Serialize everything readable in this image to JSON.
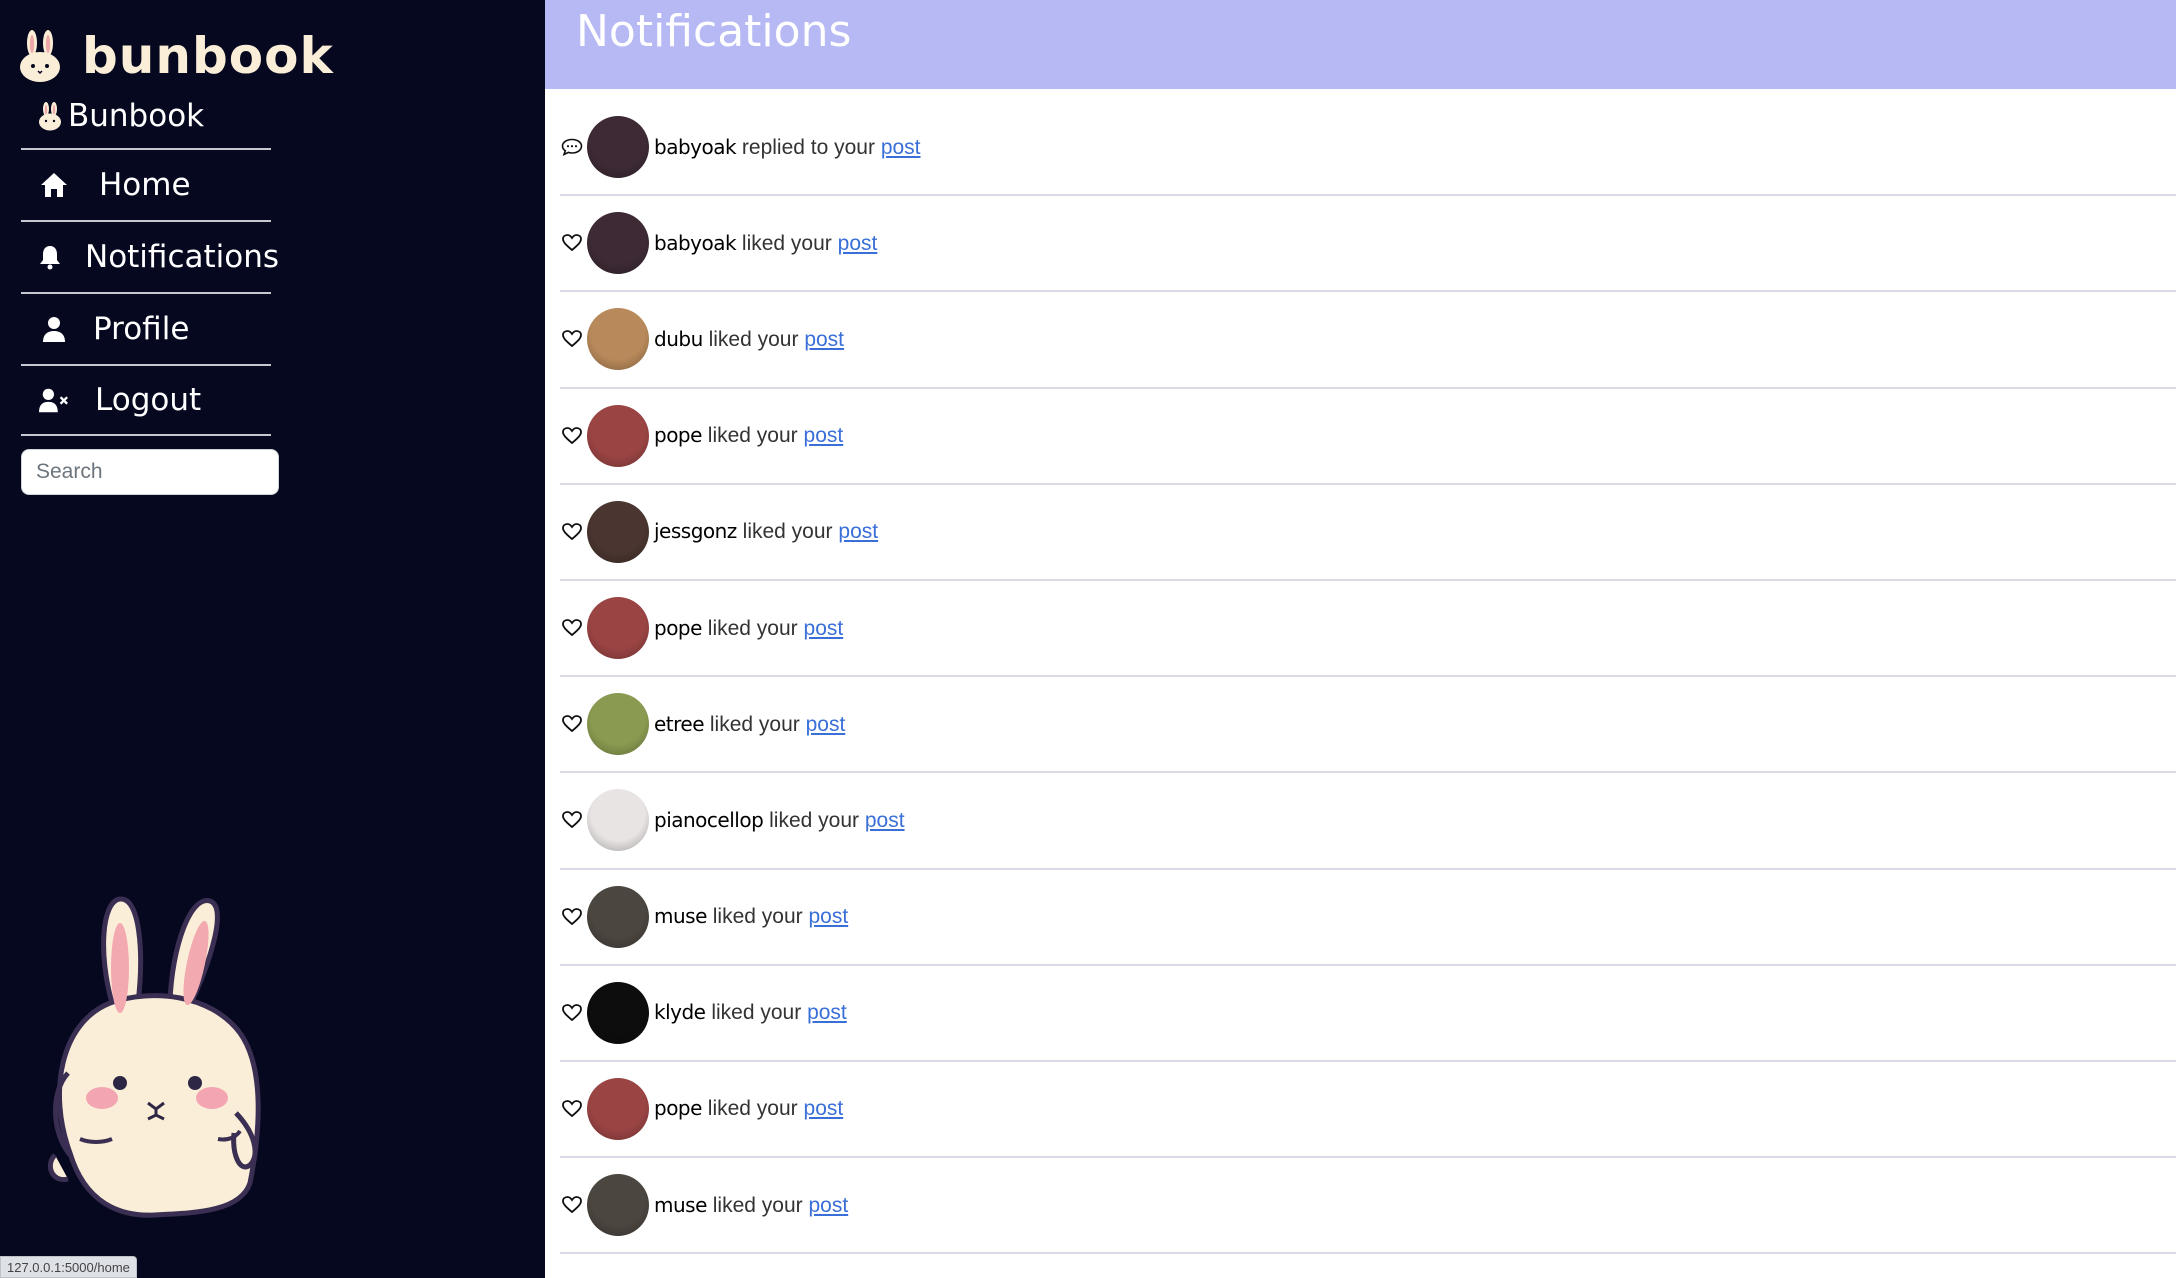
{
  "sidebar": {
    "brand": "bunbook",
    "subbrand": "Bunbook",
    "nav": [
      {
        "label": "Home",
        "icon": "home-icon"
      },
      {
        "label": "Notifications",
        "icon": "bell-icon"
      },
      {
        "label": "Profile",
        "icon": "user-icon"
      },
      {
        "label": "Logout",
        "icon": "user-x-icon"
      }
    ],
    "search_placeholder": "Search"
  },
  "status_url": "127.0.0.1:5000/home",
  "header": {
    "title": "Notifications"
  },
  "notifications": [
    {
      "type": "reply",
      "user": "babyoak",
      "action": "replied to your",
      "link": "post",
      "avatar_color": "#3d2a35"
    },
    {
      "type": "like",
      "user": "babyoak",
      "action": "liked your",
      "link": "post",
      "avatar_color": "#3d2a35"
    },
    {
      "type": "like",
      "user": "dubu",
      "action": "liked your",
      "link": "post",
      "avatar_color": "#b8895a"
    },
    {
      "type": "like",
      "user": "pope",
      "action": "liked your",
      "link": "post",
      "avatar_color": "#9b4444"
    },
    {
      "type": "like",
      "user": "jessgonz",
      "action": "liked your",
      "link": "post",
      "avatar_color": "#4a3530"
    },
    {
      "type": "like",
      "user": "pope",
      "action": "liked your",
      "link": "post",
      "avatar_color": "#9b4444"
    },
    {
      "type": "like",
      "user": "etree",
      "action": "liked your",
      "link": "post",
      "avatar_color": "#8a9a50"
    },
    {
      "type": "like",
      "user": "pianocellop",
      "action": "liked your",
      "link": "post",
      "avatar_color": "#e8e4e4"
    },
    {
      "type": "like",
      "user": "muse",
      "action": "liked your",
      "link": "post",
      "avatar_color": "#4c4640"
    },
    {
      "type": "like",
      "user": "klyde",
      "action": "liked your",
      "link": "post",
      "avatar_color": "#0d0d0d"
    },
    {
      "type": "like",
      "user": "pope",
      "action": "liked your",
      "link": "post",
      "avatar_color": "#9b4444"
    },
    {
      "type": "like",
      "user": "muse",
      "action": "liked your",
      "link": "post",
      "avatar_color": "#4c4640"
    }
  ],
  "colors": {
    "sidebar_bg": "#05081f",
    "header_bg": "#b6b9f4",
    "brand": "#fbeed8",
    "link": "#3a6fd8"
  }
}
